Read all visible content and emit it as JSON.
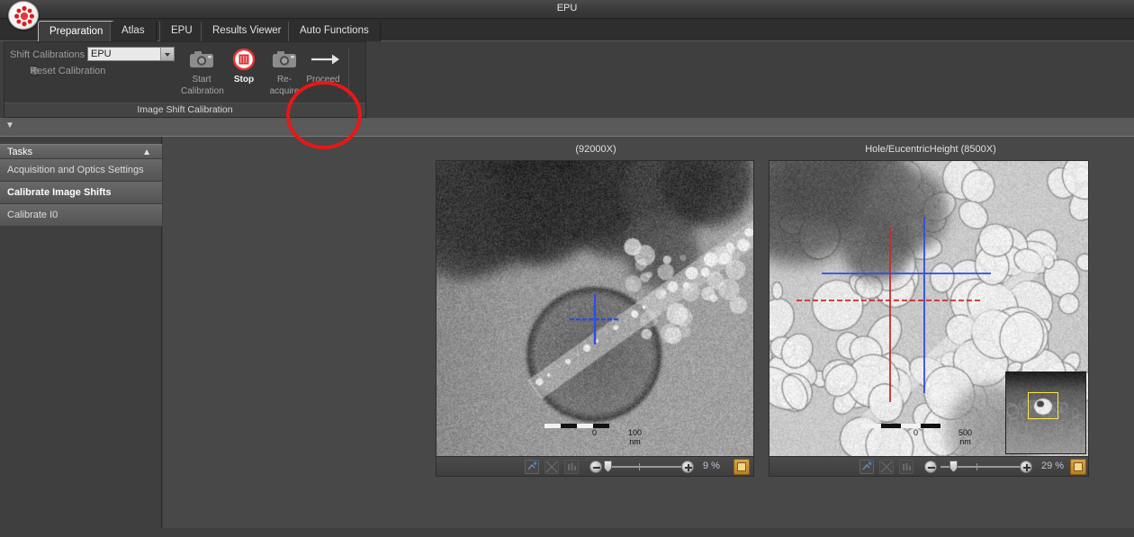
{
  "window": {
    "title": "EPU",
    "logo_icon": "fei-thermo-logo-icon"
  },
  "tabs": [
    {
      "label": "Preparation",
      "active": true
    },
    {
      "label": "Atlas",
      "active": false
    },
    {
      "label": "EPU",
      "active": false
    },
    {
      "label": "Results Viewer",
      "active": false
    },
    {
      "label": "Auto Functions",
      "active": false
    }
  ],
  "ribbon": {
    "group_title": "Image Shift Calibration",
    "shift_calibrations_label": "Shift Calibrations",
    "shift_calibrations_value": "EPU",
    "reset_calibration_label": "Reset Calibration",
    "buttons": [
      {
        "label": "Start\nCalibration",
        "label_line1": "Start",
        "label_line2": "Calibration",
        "icon": "camera-icon",
        "enabled": false
      },
      {
        "label": "Stop",
        "label_line1": "Stop",
        "label_line2": "",
        "icon": "stop-record-icon",
        "enabled": true
      },
      {
        "label": "Re-\nacquire",
        "label_line1": "Re-",
        "label_line2": "acquire",
        "icon": "camera-icon",
        "enabled": false
      },
      {
        "label": "Proceed",
        "label_line1": "Proceed",
        "label_line2": "",
        "icon": "arrow-right-icon",
        "enabled": false
      }
    ],
    "annotation": {
      "shape": "ellipse",
      "color": "#e81717",
      "target": "Proceed"
    },
    "collapse_icon": "chevron-down-icon"
  },
  "sidebar": {
    "header": "Tasks",
    "collapse_icon": "chevron-up-icon",
    "items": [
      {
        "label": "Acquisition and Optics Settings",
        "selected": false
      },
      {
        "label": "Calibrate Image Shifts",
        "selected": true
      },
      {
        "label": "Calibrate I0",
        "selected": false
      }
    ]
  },
  "panels": [
    {
      "id": "left",
      "title": "(92000X)",
      "scalebar": {
        "zero": "0",
        "value": "100 nm"
      },
      "toolbar": {
        "icons": [
          "fit-to-window-icon",
          "crosshair-overlay-icon",
          "histogram-icon"
        ],
        "zoom_out_icon": "zoom-out-icon",
        "zoom_in_icon": "zoom-in-icon",
        "zoom_percent": "9 %",
        "active_toggle_icon": "image-preset-icon"
      },
      "crosshairs": [
        {
          "color": "#2a4fe0",
          "name": "beam-shift-crosshair"
        }
      ]
    },
    {
      "id": "right",
      "title": "Hole/EucentricHeight (8500X)",
      "scalebar": {
        "zero": "0",
        "value": "500 nm"
      },
      "toolbar": {
        "icons": [
          "fit-to-window-icon",
          "crosshair-overlay-icon",
          "histogram-icon"
        ],
        "zoom_out_icon": "zoom-out-icon",
        "zoom_in_icon": "zoom-in-icon",
        "zoom_percent": "29 %",
        "active_toggle_icon": "image-preset-icon"
      },
      "crosshairs": [
        {
          "color": "#c92b2b",
          "name": "reference-crosshair"
        },
        {
          "color": "#2a4fe0",
          "name": "beam-shift-crosshair"
        }
      ],
      "inset": {
        "name": "navigator-thumbnail",
        "selection_color": "#ffe54a"
      }
    }
  ],
  "colors": {
    "accent_orange": "#c98b2c",
    "annotation_red": "#e81717",
    "crosshair_blue": "#2a4fe0",
    "crosshair_red": "#c92b2b",
    "panel_bg": "#3f3f3f",
    "workarea_bg": "#484848"
  }
}
